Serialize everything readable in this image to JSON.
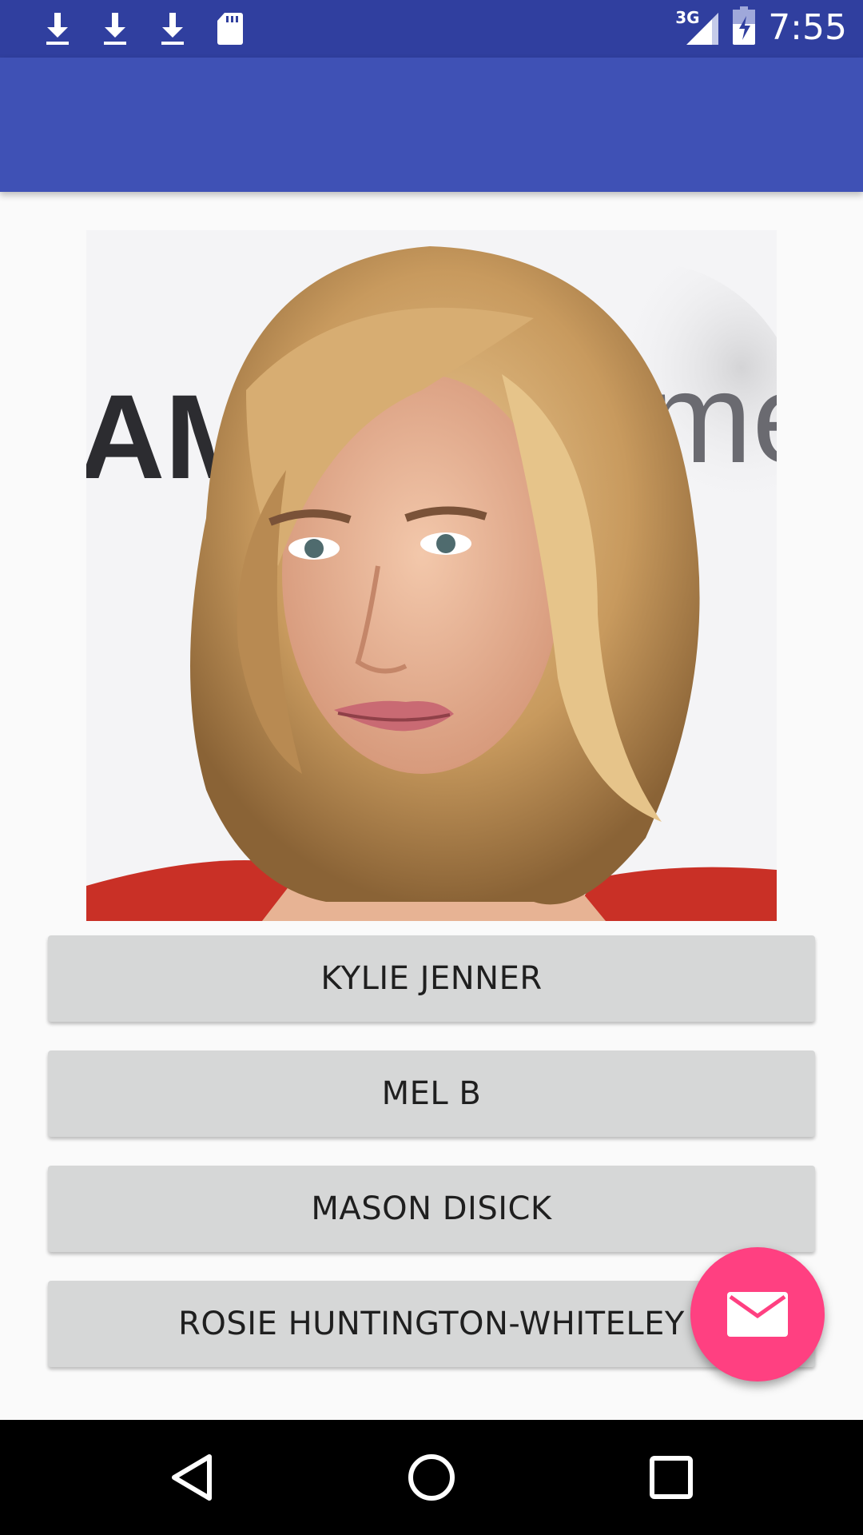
{
  "status_bar": {
    "time": "7:55",
    "network": "3G",
    "icons": [
      "download-icon",
      "download-icon",
      "download-icon",
      "sd-card-icon",
      "signal-icon",
      "battery-charging-icon"
    ]
  },
  "app_bar": {
    "title": ""
  },
  "photo": {
    "subject": "celebrity-portrait",
    "background_text": "AM me"
  },
  "answers": [
    {
      "label": "KYLIE JENNER"
    },
    {
      "label": "MEL B"
    },
    {
      "label": "MASON DISICK"
    },
    {
      "label": "ROSIE HUNTINGTON-WHITELEY"
    }
  ],
  "fab": {
    "icon": "email-icon",
    "color": "#ff4081"
  },
  "nav_bar": {
    "icons": [
      "back-icon",
      "home-icon",
      "recents-icon"
    ]
  },
  "colors": {
    "primary": "#3f51b5",
    "primary_dark": "#303f9f",
    "accent": "#ff4081",
    "button": "#d6d7d7"
  }
}
